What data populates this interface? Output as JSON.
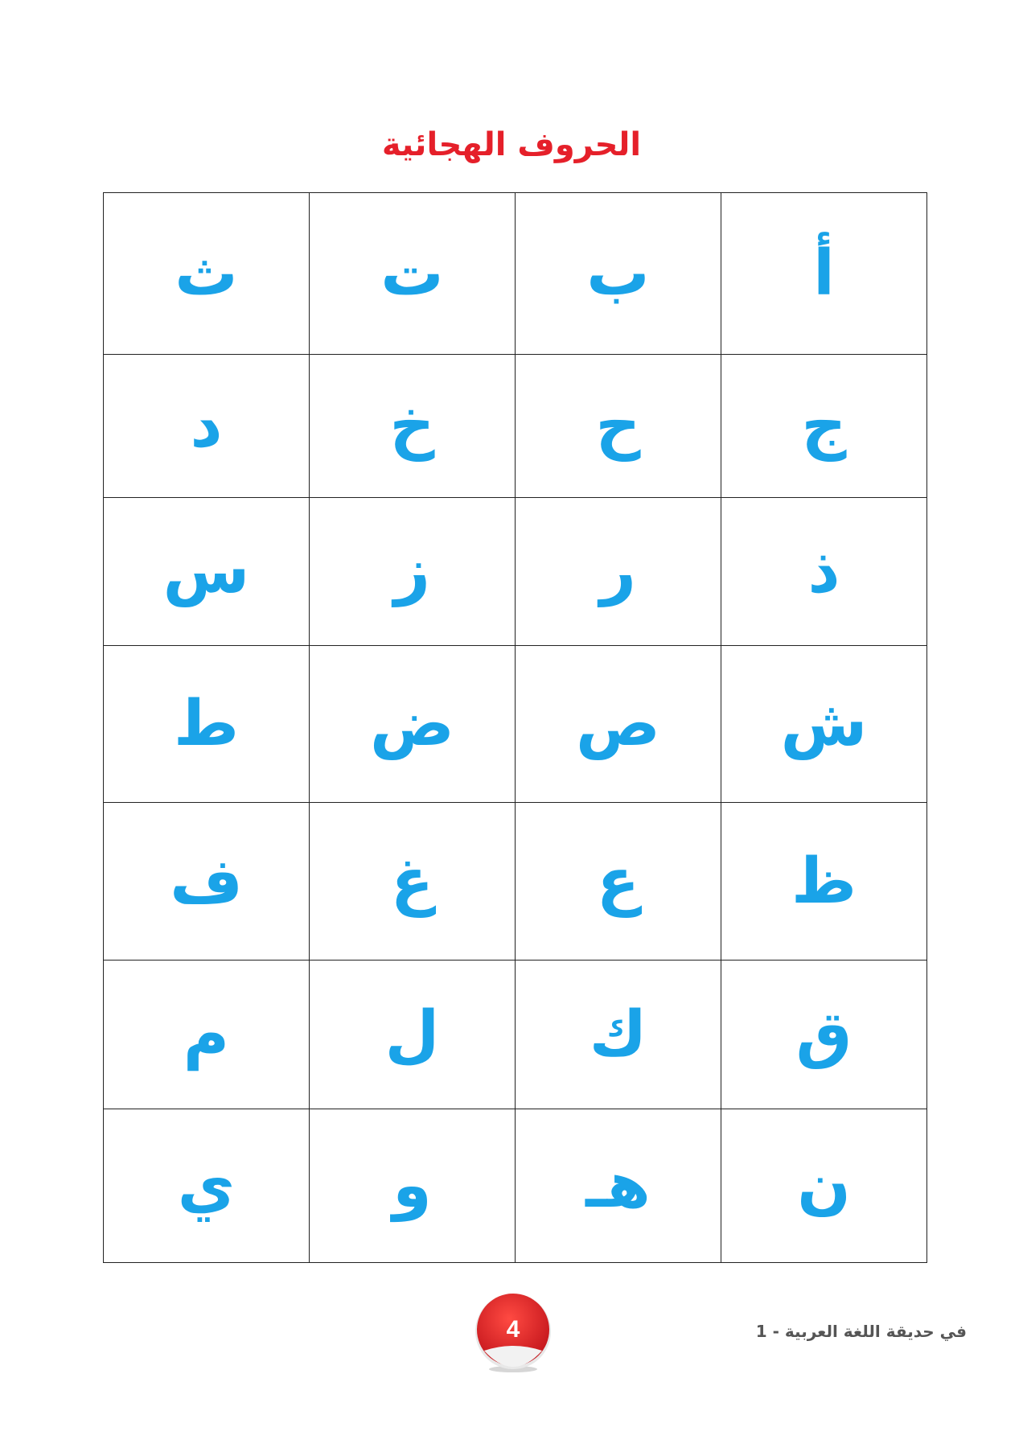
{
  "title": "الحروف الهجائية",
  "letters": [
    [
      "أ",
      "ب",
      "ت",
      "ث"
    ],
    [
      "ج",
      "ح",
      "خ",
      "د"
    ],
    [
      "ذ",
      "ر",
      "ز",
      "س"
    ],
    [
      "ش",
      "ص",
      "ض",
      "ط"
    ],
    [
      "ظ",
      "ع",
      "غ",
      "ف"
    ],
    [
      "ق",
      "ك",
      "ل",
      "م"
    ],
    [
      "ن",
      "هـ",
      "و",
      "ي"
    ]
  ],
  "footer": {
    "page_number": "4",
    "series": "في حديقة اللغة العربية - 1"
  },
  "colors": {
    "title": "#e5202a",
    "letters": "#1aa3e8",
    "badge": "#e5202a"
  }
}
